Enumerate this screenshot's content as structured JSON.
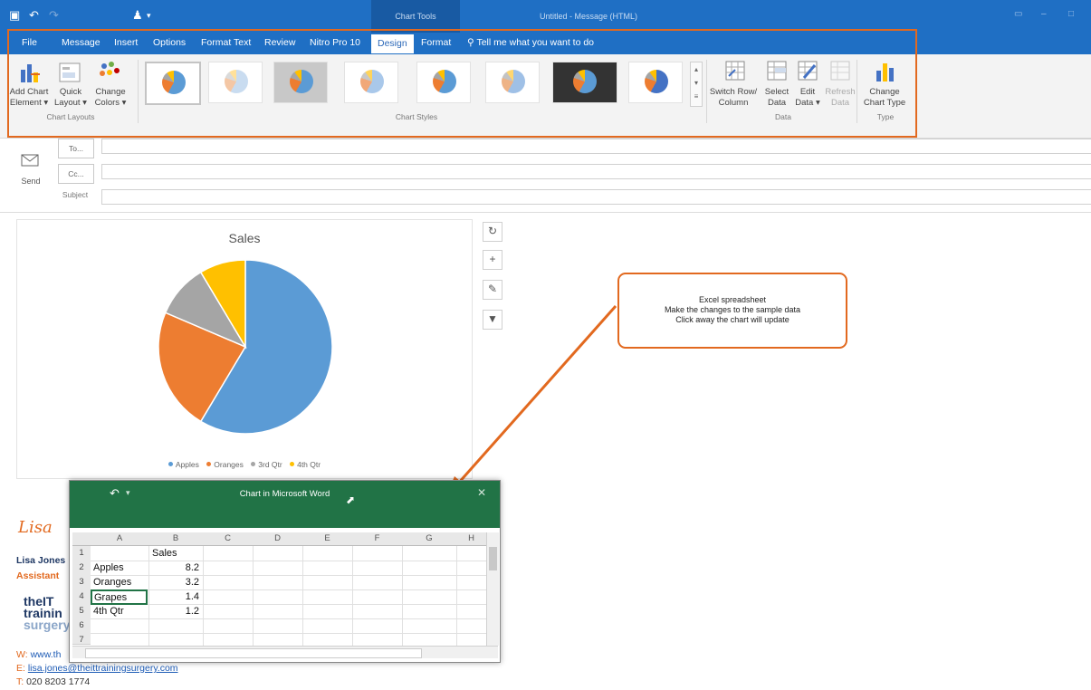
{
  "colors": {
    "accent_blue": "#1f6fc4",
    "excel_green": "#217346",
    "highlight_orange": "#e2691f",
    "pie_apples": "#5b9bd5",
    "pie_oranges": "#ed7d31",
    "pie_3rd": "#a5a5a5",
    "pie_4th": "#ffc000",
    "link": "#1d5bb5"
  },
  "titlebar": {
    "context_tools": "Chart Tools",
    "doc_title": "Untitled - Message (HTML)"
  },
  "tabs": [
    "File",
    "Message",
    "Insert",
    "Options",
    "Format Text",
    "Review",
    "Nitro Pro 10",
    "Design",
    "Format"
  ],
  "tell_me": "Tell me what you want to do",
  "ribbon": {
    "add_chart_element": [
      "Add Chart",
      "Element"
    ],
    "quick_layout": [
      "Quick",
      "Layout"
    ],
    "change_colors": [
      "Change",
      "Colors"
    ],
    "switch_row_column": [
      "Switch Row/",
      "Column"
    ],
    "select_data": [
      "Select",
      "Data"
    ],
    "edit_data": [
      "Edit",
      "Data"
    ],
    "refresh_data": [
      "Refresh",
      "Data"
    ],
    "change_chart_type": [
      "Change",
      "Chart Type"
    ],
    "groups": {
      "chart_layouts": "Chart Layouts",
      "chart_styles": "Chart Styles",
      "data": "Data",
      "type": "Type"
    }
  },
  "compose": {
    "to": "To...",
    "cc": "Cc...",
    "subject": "Subject",
    "send": "Send"
  },
  "chart_data": {
    "type": "pie",
    "title": "Sales",
    "categories": [
      "Apples",
      "Oranges",
      "3rd Qtr",
      "4th Qtr"
    ],
    "values": [
      8.2,
      3.2,
      1.4,
      1.2
    ],
    "colors": [
      "#5b9bd5",
      "#ed7d31",
      "#a5a5a5",
      "#ffc000"
    ],
    "legend_position": "bottom"
  },
  "callout": [
    "Excel spreadsheet",
    "Make the changes to the sample data",
    "Click away the chart will update"
  ],
  "excel": {
    "title": "Chart in Microsoft Word",
    "columns": [
      "A",
      "B",
      "C",
      "D",
      "E",
      "F",
      "G",
      "H"
    ],
    "rows": [
      "1",
      "2",
      "3",
      "4",
      "5",
      "6",
      "7"
    ],
    "header": "Sales",
    "cells": [
      [
        "Apples",
        "8.2"
      ],
      [
        "Oranges",
        "3.2"
      ],
      [
        "Grapes",
        "1.4"
      ],
      [
        "4th Qtr",
        "1.2"
      ]
    ]
  },
  "signature": {
    "name_script": "Lisa",
    "name": "Lisa Jones",
    "role": "Assistant",
    "logo": [
      "theIT",
      "trainin",
      "surgery"
    ],
    "web_prefix": "W:",
    "web": "www.th",
    "email_prefix": "E:",
    "email": "lisa.jones@theittrainingsurgery.com",
    "tel_prefix": "T:",
    "tel": "020 8203 1774"
  }
}
